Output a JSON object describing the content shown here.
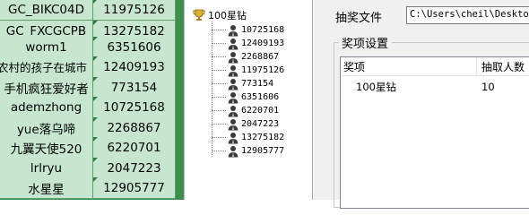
{
  "sheet": {
    "rows": [
      {
        "name": "GC_BIKC04D",
        "value": "11975126"
      },
      {
        "name": "GC_FXCGCPB",
        "value": "13275182"
      },
      {
        "name": "worm1",
        "value": "6351606"
      },
      {
        "name": "农村的孩子在城市",
        "value": "12409193"
      },
      {
        "name": "手机疯狂爱好者",
        "value": "773154"
      },
      {
        "name": "ademzhong",
        "value": "10725168"
      },
      {
        "name": "yue落乌啼",
        "value": "2268867"
      },
      {
        "name": "九翼天使520",
        "value": "6220701"
      },
      {
        "name": "lrlryu",
        "value": "2047223"
      },
      {
        "name": "水星星",
        "value": "12905777"
      }
    ]
  },
  "tree": {
    "root_label": "100星钻",
    "items": [
      "10725168",
      "12409193",
      "2268867",
      "11975126",
      "773154",
      "6351606",
      "6220701",
      "2047223",
      "13275182",
      "12905777"
    ]
  },
  "panel": {
    "file_label": "抽奖文件",
    "file_path": "C:\\Users\\cheil\\Desktop",
    "group_title": "奖项设置",
    "columns": [
      "奖项",
      "抽取人数"
    ],
    "rows": [
      {
        "prize": "100星钻",
        "count": "10"
      }
    ]
  },
  "colors": {
    "sheet_cell": "#c6e6cf",
    "sheet_background": "#3d8f4b",
    "panel_background": "#f0f0f0"
  },
  "icons": {
    "root": "trophy-icon",
    "leaf": "person-icon"
  }
}
